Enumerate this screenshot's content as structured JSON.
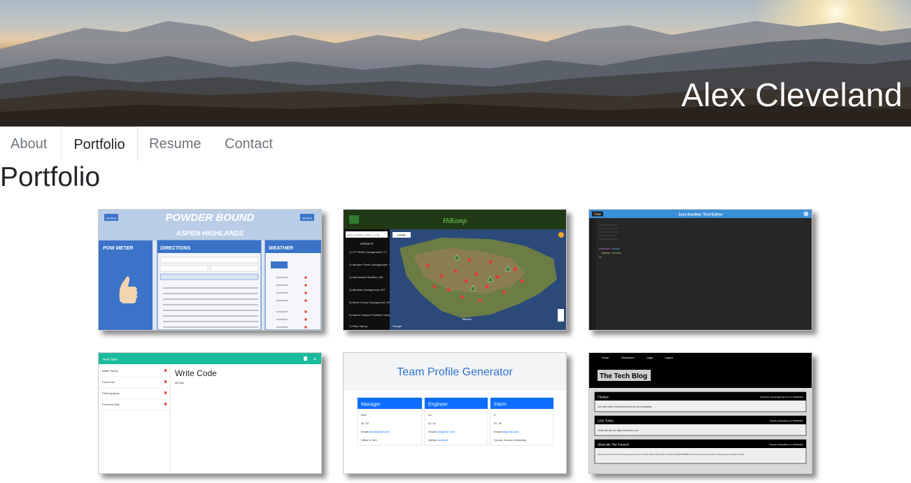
{
  "header": {
    "name": "Alex Cleveland"
  },
  "nav": {
    "items": [
      "About",
      "Portfolio",
      "Resume",
      "Contact"
    ],
    "active": "Portfolio"
  },
  "page": {
    "title": "Portfolio"
  },
  "projects": [
    {
      "id": "powder-bound",
      "title": "POWDER BOUND",
      "subtitle": "ASPEN HIGHLANDS",
      "left_btn": "SEARCH",
      "right_btn": "SEARCH",
      "panels": [
        "POW METER",
        "DIRECTIONS",
        "WEATHER"
      ],
      "accent": "#3a73c8"
    },
    {
      "id": "hikamp",
      "title": "HiKamp",
      "search_placeholder": "Enter Campsite, State, or City",
      "map_label": "Satellite",
      "results_label": "▾ RESULTS",
      "results": [
        "1) 277 North Campground, TX",
        "2) Abrams Creek Campground, TN",
        "3) Adirondack Shelters, MD",
        "4) Afterbay Campground, MT",
        "5) Akers Group Campground, MO",
        "6) Alamo Canyon Primitive Campground, AZ",
        "7) Alley Spring"
      ],
      "map_footer": "Google",
      "map_place": "Mexico",
      "accent": "#1e5f1e"
    },
    {
      "id": "text-editor",
      "title": "Just Another Text Editor",
      "install_label": "Install",
      "accent": "#3a8fd9"
    },
    {
      "id": "note-taker",
      "title": "Note Taker",
      "notes": [
        "Water Plants",
        "Feed Fish",
        "Feed Iguanas",
        "Feed the Kitty"
      ],
      "active_note_title": "Write Code",
      "active_note_text": "All Day",
      "accent": "#1abc9c"
    },
    {
      "id": "team-profile",
      "title": "Team Profile Generator",
      "members": [
        {
          "role": "Manager",
          "name": "Alex",
          "id": "ID: 33",
          "email_label": "Email:",
          "email": "alex@gmail.com",
          "extra": "Office #: 344"
        },
        {
          "role": "Engineer",
          "name": "AJ",
          "id": "ID: 34",
          "email_label": "Email:",
          "email": "AJ@gmail.com",
          "extra_label": "GitHub:",
          "extra": "Achlee3"
        },
        {
          "role": "Intern",
          "name": "K",
          "id": "ID: 35",
          "email_label": "Email:",
          "email": "k@gmail.com",
          "extra": "School: Denver University"
        }
      ],
      "accent": "#0d6efd"
    },
    {
      "id": "tech-blog",
      "title": "The Tech Blog",
      "nav": [
        "Home",
        "Dashboard",
        "Login",
        "Logout"
      ],
      "posts": [
        {
          "title": "Flexbox",
          "meta": "Posted by acline87@gmail.com on 02/28/2022",
          "body": "Can have weird errors that prevent you from deploying"
        },
        {
          "title": "CSS-Tricks",
          "meta": "Posted by BeepBoop on 02/28/2022",
          "body": "Check this site out: https://css-tricks.com/"
        },
        {
          "title": "Show Me The Funny!!!",
          "meta": "Posted by BeepBoop on 02/28/2022",
          "body": "Here are some funny lorem ipsum generators for your mockups: https://www.shopify.com/partners/blog/79940998-15-funny-lorem-ipsum-generators-to-shake-up-your-design-mockups"
        }
      ],
      "accent": "#000000"
    }
  ]
}
